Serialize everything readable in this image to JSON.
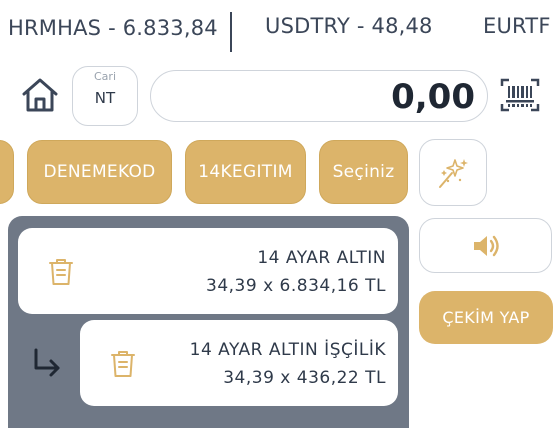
{
  "ticker": {
    "items": [
      {
        "label": "HRMHAS - 6.833,84"
      },
      {
        "label": "USDTRY - 48,48"
      },
      {
        "label": "EURTF"
      }
    ]
  },
  "toolbar": {
    "home_icon": "home-icon",
    "cari": {
      "label": "Cari",
      "value": "NT"
    },
    "amount": "0,00",
    "barcode_icon": "barcode-scan-icon"
  },
  "chips": [
    {
      "label": ""
    },
    {
      "label": "DENEMEKOD"
    },
    {
      "label": "14KEGITIM"
    },
    {
      "label": "Seçiniz"
    }
  ],
  "magic_icon": "magic-wand-stars-icon",
  "items": [
    {
      "name": "14 AYAR ALTIN",
      "detail": "34,39 x 6.834,16 TL",
      "sub": false
    },
    {
      "name": "14 AYAR ALTIN İŞÇİLİK",
      "detail": "34,39 x 436,22 TL",
      "sub": true
    }
  ],
  "actions": {
    "sound_icon": "speaker-icon",
    "cekim_label": "ÇEKİM YAP"
  },
  "colors": {
    "gold": "#dcb46a",
    "panel": "#6f7886",
    "text": "#2f3a4a"
  }
}
